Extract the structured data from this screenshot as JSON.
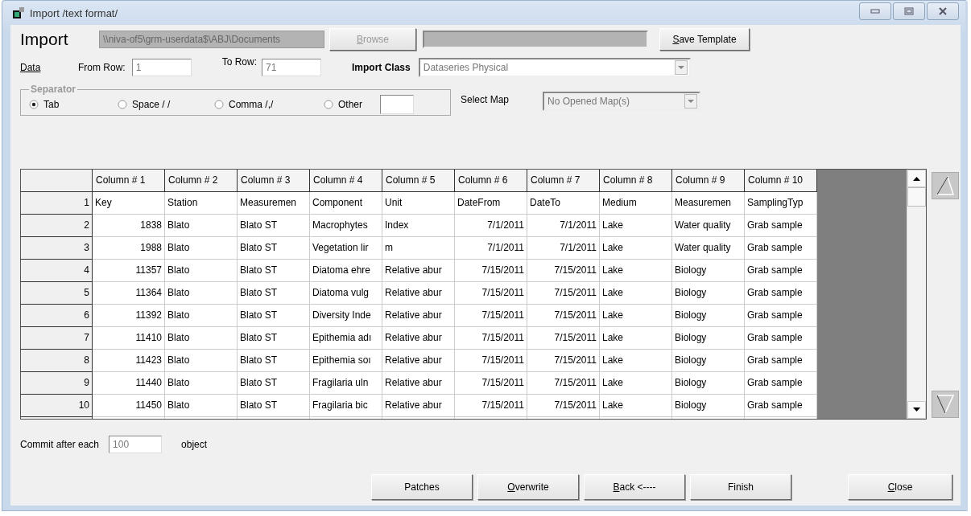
{
  "window": {
    "title": "Import /text format/"
  },
  "import": {
    "heading": "Import",
    "path": "\\\\niva-of5\\grm-userdata$\\ABJ\\Documents",
    "browse": {
      "label": "Browse",
      "underline_first": true,
      "disabled": true
    },
    "save_template": {
      "label": "Save Template",
      "underline_first": true,
      "disabled": false
    }
  },
  "data_link": "Data",
  "from_row": {
    "label": "From Row:",
    "value": "1"
  },
  "to_row": {
    "label": "To Row:",
    "value": "71"
  },
  "import_class": {
    "label": "Import Class",
    "value": "Dataseries Physical"
  },
  "separator": {
    "legend": "Separator",
    "options": [
      {
        "label": "Tab",
        "selected": true
      },
      {
        "label": "Space / /",
        "selected": false
      },
      {
        "label": "Comma /,/",
        "selected": false
      },
      {
        "label": "Other",
        "selected": false
      }
    ]
  },
  "select_map": {
    "label": "Select Map",
    "value": "No Opened Map(s)"
  },
  "table": {
    "columns": [
      {
        "label": "Column # 1",
        "kind": "number"
      },
      {
        "label": "Column # 2",
        "kind": "text"
      },
      {
        "label": "Column # 3",
        "kind": "text"
      },
      {
        "label": "Column # 4",
        "kind": "text"
      },
      {
        "label": "Column # 5",
        "kind": "text"
      },
      {
        "label": "Column # 6",
        "kind": "number"
      },
      {
        "label": "Column # 7",
        "kind": "number"
      },
      {
        "label": "Column # 8",
        "kind": "text"
      },
      {
        "label": "Column # 9",
        "kind": "text"
      },
      {
        "label": "Column # 10",
        "kind": "text"
      }
    ],
    "rows": [
      {
        "n": "1",
        "kind": "titles",
        "cells": [
          "Key",
          "Station",
          "Measuremen",
          "Component",
          "Unit",
          "DateFrom",
          "DateTo",
          "Medium",
          "Measuremen",
          "SamplingTyp"
        ]
      },
      {
        "n": "2",
        "kind": "values",
        "cells": [
          "1838",
          "Blato",
          "Blato ST",
          "Macrophytes",
          "Index",
          "7/1/2011",
          "7/1/2011",
          "Lake",
          "Water quality",
          "Grab sample"
        ]
      },
      {
        "n": "3",
        "kind": "values",
        "cells": [
          "1988",
          "Blato",
          "Blato ST",
          "Vegetation lir",
          "m",
          "7/1/2011",
          "7/1/2011",
          "Lake",
          "Water quality",
          "Grab sample"
        ]
      },
      {
        "n": "4",
        "kind": "values",
        "cells": [
          "11357",
          "Blato",
          "Blato ST",
          "Diatoma ehre",
          "Relative abur",
          "7/15/2011",
          "7/15/2011",
          "Lake",
          "Biology",
          "Grab sample"
        ]
      },
      {
        "n": "5",
        "kind": "values",
        "cells": [
          "11364",
          "Blato",
          "Blato ST",
          "Diatoma vulg",
          "Relative abur",
          "7/15/2011",
          "7/15/2011",
          "Lake",
          "Biology",
          "Grab sample"
        ]
      },
      {
        "n": "6",
        "kind": "values",
        "cells": [
          "11392",
          "Blato",
          "Blato ST",
          "Diversity Inde",
          "Relative abur",
          "7/15/2011",
          "7/15/2011",
          "Lake",
          "Biology",
          "Grab sample"
        ]
      },
      {
        "n": "7",
        "kind": "values",
        "cells": [
          "11410",
          "Blato",
          "Blato ST",
          "Epithemia adı",
          "Relative abur",
          "7/15/2011",
          "7/15/2011",
          "Lake",
          "Biology",
          "Grab sample"
        ]
      },
      {
        "n": "8",
        "kind": "values",
        "cells": [
          "11423",
          "Blato",
          "Blato ST",
          "Epithemia soı",
          "Relative abur",
          "7/15/2011",
          "7/15/2011",
          "Lake",
          "Biology",
          "Grab sample"
        ]
      },
      {
        "n": "9",
        "kind": "values",
        "cells": [
          "11440",
          "Blato",
          "Blato ST",
          "Fragilaria uln",
          "Relative abur",
          "7/15/2011",
          "7/15/2011",
          "Lake",
          "Biology",
          "Grab sample"
        ]
      },
      {
        "n": "10",
        "kind": "values",
        "cells": [
          "11450",
          "Blato",
          "Blato ST",
          "Fragilaria bic",
          "Relative abur",
          "7/15/2011",
          "7/15/2011",
          "Lake",
          "Biology",
          "Grab sample"
        ]
      }
    ]
  },
  "commit": {
    "label": "Commit after each",
    "value": "100",
    "suffix": "object"
  },
  "buttons": [
    {
      "label": "Patches",
      "underline_first": false,
      "kind": "action"
    },
    {
      "label": "Overwrite",
      "underline_first": true,
      "kind": "action"
    },
    {
      "label": "Back <----",
      "underline_first": true,
      "kind": "action"
    },
    {
      "label": "Finish",
      "underline_first": false,
      "kind": "action"
    },
    {
      "label": "Close",
      "underline_first": true,
      "kind": "close"
    }
  ]
}
